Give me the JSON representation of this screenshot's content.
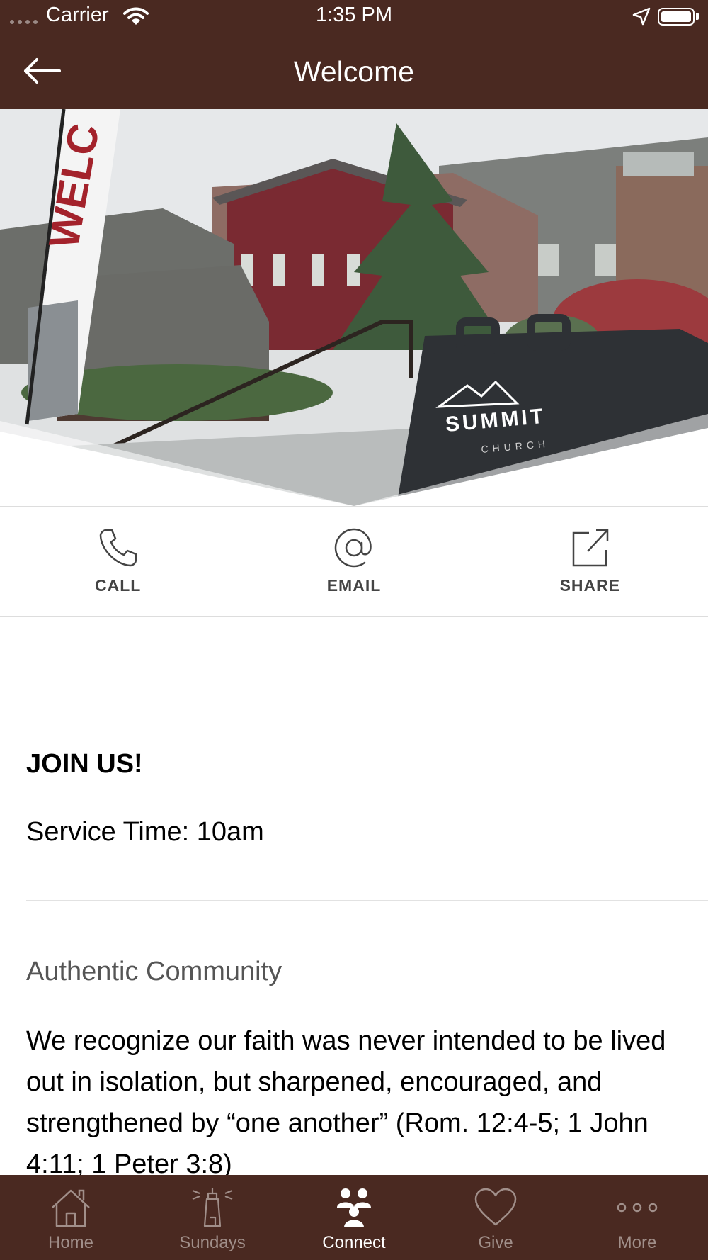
{
  "status_bar": {
    "carrier": "Carrier",
    "time": "1:35 PM"
  },
  "nav": {
    "title": "Welcome"
  },
  "hero": {
    "banner_text": "WELC",
    "sign_text": "SUMMIT",
    "sign_subtext": "CHURCH"
  },
  "actions": [
    {
      "label": "CALL",
      "icon": "phone-icon"
    },
    {
      "label": "EMAIL",
      "icon": "at-icon"
    },
    {
      "label": "SHARE",
      "icon": "share-icon"
    }
  ],
  "content": {
    "heading": "JOIN US!",
    "service_time": "Service Time: 10am",
    "subheading": "Authentic Community",
    "body": "We recognize our faith was never intended to be lived out in isolation, but sharpened, encouraged, and strengthened by “one another” (Rom. 12:4-5; 1 John 4:11; 1 Peter 3:8)"
  },
  "tabs": [
    {
      "label": "Home",
      "icon": "home-icon",
      "active": false
    },
    {
      "label": "Sundays",
      "icon": "lighthouse-icon",
      "active": false
    },
    {
      "label": "Connect",
      "icon": "people-icon",
      "active": true
    },
    {
      "label": "Give",
      "icon": "heart-icon",
      "active": false
    },
    {
      "label": "More",
      "icon": "more-icon",
      "active": false
    }
  ],
  "colors": {
    "brand": "#4a2921",
    "tab_inactive": "#a18f8a",
    "tab_active": "#ffffff"
  }
}
